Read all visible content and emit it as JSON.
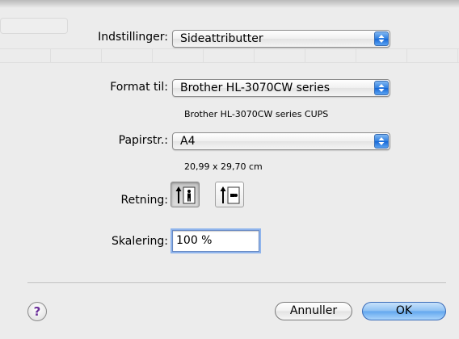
{
  "settings": {
    "label": "Indstillinger:",
    "value": "Sideattributter"
  },
  "format": {
    "label": "Format til:",
    "value": "Brother HL-3070CW series",
    "sublabel": "Brother HL-3070CW series CUPS"
  },
  "paper": {
    "label": "Papirstr.:",
    "value": "A4",
    "dimensions": "20,99 x 29,70 cm"
  },
  "orientation": {
    "label": "Retning:",
    "options": [
      "portrait",
      "landscape"
    ],
    "selected": "portrait"
  },
  "scale": {
    "label": "Skalering:",
    "value": "100 %"
  },
  "buttons": {
    "help": "?",
    "cancel": "Annuller",
    "ok": "OK"
  },
  "colors": {
    "accent": "#2f7fe0",
    "ok_button": "#8cc0f3",
    "focus_ring": "#8fb4ec"
  }
}
